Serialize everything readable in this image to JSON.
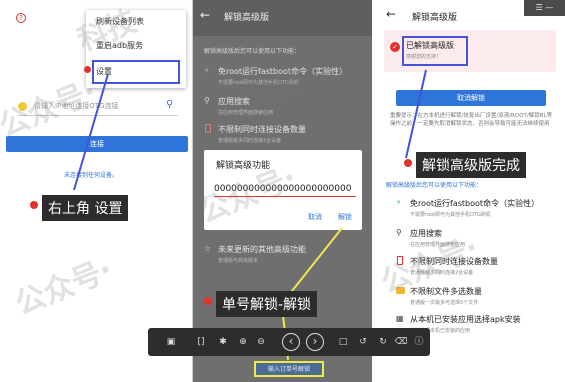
{
  "panel1": {
    "menu": [
      "刷新设备列表",
      "重启adb服务",
      "设置"
    ],
    "search_placeholder": "请输入IP地址连接OTG连接",
    "connect_btn": "连接",
    "hint_text": "未连接到任何设备。",
    "callout": "右上角 设置"
  },
  "panel2": {
    "title": "解锁高级版",
    "intro": "解锁高级版后您可以使用以下功能：",
    "features": [
      {
        "title": "免root运行fastboot命令（实验性）",
        "sub": "不需要root即可为其他手机OTG刷机"
      },
      {
        "title": "应用搜索",
        "sub": "在应用管理界面搜索应用"
      },
      {
        "title": "不限制同时连接设备数量",
        "sub": "普通版最多同时连接2台设备"
      },
      {
        "title": "未来更新的其他高级功能",
        "sub": "普通版与高级版本"
      }
    ],
    "dialog": {
      "title": "解锁高级功能",
      "code": "000000000000000000000000",
      "cancel": "取消",
      "unlock": "解锁"
    },
    "callout": "单号解锁-解锁",
    "bottom_btn": "输入订单号解锁"
  },
  "panel3": {
    "title": "解锁高级版",
    "card_title": "已解锁高级版",
    "card_sub": "感谢您的支持！",
    "cancel_unlock_btn": "取消解锁",
    "note": "重要提示：在方本机进行解锁/恢复出厂设置/双清/ROOT/解锁BL等操作之前，一定要先取消解锁状态，否则会导致可能无法继续使用",
    "callout": "解锁高级版完成",
    "intro": "解锁高级版后您可以使用以下功能：",
    "features": [
      {
        "title": "免root运行fastboot命令（实验性）",
        "sub": "不需要root即可为其他手机OTG刷机"
      },
      {
        "title": "应用搜索",
        "sub": "在应用管理界面搜索应用"
      },
      {
        "title": "不限制同时连接设备数量",
        "sub": "普通版最多同时连接2台设备"
      },
      {
        "title": "不限制文件多选数量",
        "sub": "普通版一次最多可选择5个文件"
      },
      {
        "title": "从本机已安装应用选择apk安装",
        "sub": "直接选择本机已安装的应用"
      }
    ]
  },
  "toolbar": {
    "icons": [
      "crop-icon",
      "text-icon",
      "color-icon",
      "zoom-in-icon",
      "zoom-out-icon",
      "prev-icon",
      "next-icon",
      "comment-icon",
      "rotate-left-icon",
      "rotate-right-icon",
      "delete-icon",
      "info-icon"
    ]
  },
  "watermarks": [
    "公众号·",
    "科技",
    "公众号·",
    "公众号·",
    "科技",
    "公众号·"
  ],
  "colors": {
    "accent": "#2f74d8",
    "callout_bg": "#2c2c2c",
    "red": "#e2322b",
    "highlight": "#4355d6",
    "yellow": "#f2e84a"
  }
}
